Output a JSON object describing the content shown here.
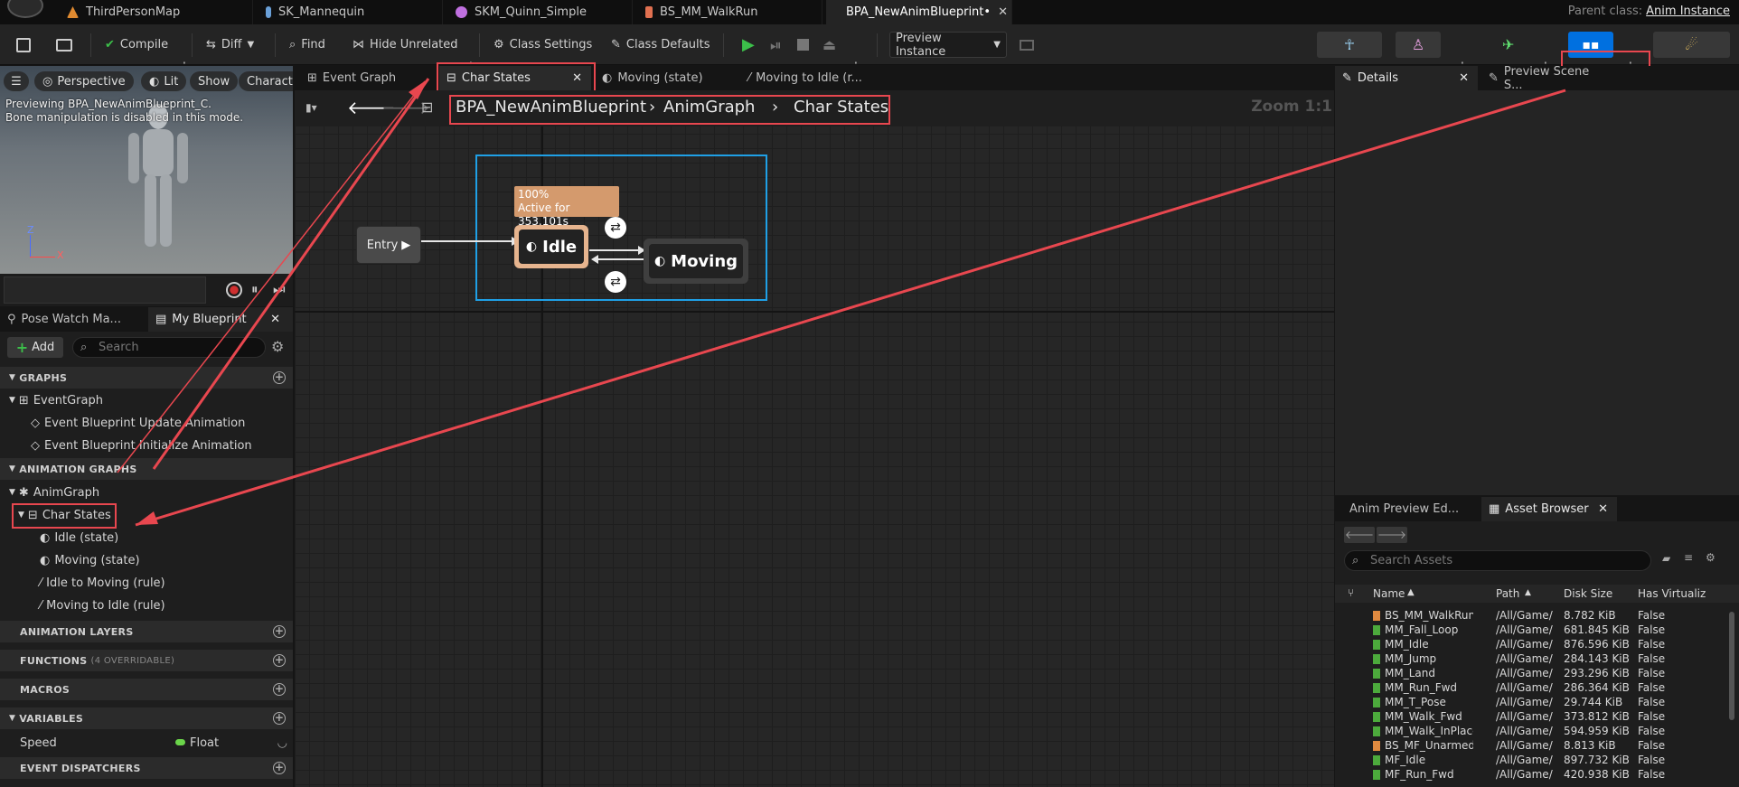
{
  "doc_tabs": [
    {
      "label": "ThirdPersonMap",
      "icon": "level-icon",
      "color": "#e08a30"
    },
    {
      "label": "SK_Mannequin",
      "icon": "skeleton-icon",
      "color": "#6aa0d8"
    },
    {
      "label": "SKM_Quinn_Simple",
      "icon": "skeletal-mesh-icon",
      "color": "#c070e0"
    },
    {
      "label": "BS_MM_WalkRun",
      "icon": "blendspace-icon",
      "color": "#e07050"
    },
    {
      "label": "BPA_NewAnimBlueprint•",
      "icon": "anim-blueprint-icon",
      "color": "#e07050"
    }
  ],
  "parent_class": {
    "label": "Parent class:",
    "value": "Anim Instance"
  },
  "toolbar": {
    "compile": "Compile",
    "diff": "Diff",
    "find": "Find",
    "hide_unrelated": "Hide Unrelated",
    "class_settings": "Class Settings",
    "class_defaults": "Class Defaults",
    "preview_instance": "Preview Instance"
  },
  "viewport": {
    "chips": [
      "Perspective",
      "Lit",
      "Show",
      "Characte"
    ],
    "note_line1": "Previewing BPA_NewAnimBlueprint_C.",
    "note_line2": "Bone manipulation is disabled in this mode."
  },
  "left_tabs": {
    "pose_watch": "Pose Watch Ma...",
    "my_blueprint": "My Blueprint"
  },
  "my_blueprint": {
    "add_label": "Add",
    "search_placeholder": "Search",
    "graphs_header": "GRAPHS",
    "event_graph": "EventGraph",
    "event_update": "Event Blueprint Update Animation",
    "event_init": "Event Blueprint Initialize Animation",
    "anim_graphs_header": "ANIMATION GRAPHS",
    "anim_graph": "AnimGraph",
    "char_states": "Char States",
    "idle_state": "Idle (state)",
    "moving_state": "Moving (state)",
    "idle_to_moving": "Idle to Moving (rule)",
    "moving_to_idle": "Moving to Idle (rule)",
    "anim_layers_header": "ANIMATION LAYERS",
    "functions_header": "FUNCTIONS",
    "functions_note": "(4 OVERRIDABLE)",
    "macros_header": "MACROS",
    "variables_header": "VARIABLES",
    "var_name": "Speed",
    "var_type": "Float",
    "dispatchers_header": "EVENT DISPATCHERS"
  },
  "graph_tabs": [
    "Event Graph",
    "Char States",
    "Moving (state)",
    "Moving to Idle (r..."
  ],
  "breadcrumb": [
    "BPA_NewAnimBlueprint",
    "AnimGraph",
    "Char States"
  ],
  "zoom": "Zoom 1:1",
  "graph": {
    "entry": "Entry",
    "idle": "Idle",
    "moving": "Moving",
    "tooltip_line1": "100%",
    "tooltip_line2": "Active for 353.101s"
  },
  "right_tabs": {
    "details": "Details",
    "preview_scene": "Preview Scene S..."
  },
  "bottom_tabs": {
    "anim_preview": "Anim Preview Ed...",
    "asset_browser": "Asset Browser"
  },
  "asset_browser": {
    "search_placeholder": "Search Assets",
    "columns": [
      "Name",
      "Path",
      "Disk Size",
      "Has Virtualiz"
    ],
    "rows": [
      {
        "name": "BS_MM_WalkRun",
        "path": "/All/Game/",
        "size": "8.782 KiB",
        "virt": "False",
        "type": "blendspace"
      },
      {
        "name": "MM_Fall_Loop",
        "path": "/All/Game/",
        "size": "681.845 KiB",
        "virt": "False",
        "type": "anim"
      },
      {
        "name": "MM_Idle",
        "path": "/All/Game/",
        "size": "876.596 KiB",
        "virt": "False",
        "type": "anim"
      },
      {
        "name": "MM_Jump",
        "path": "/All/Game/",
        "size": "284.143 KiB",
        "virt": "False",
        "type": "anim"
      },
      {
        "name": "MM_Land",
        "path": "/All/Game/",
        "size": "293.296 KiB",
        "virt": "False",
        "type": "anim"
      },
      {
        "name": "MM_Run_Fwd",
        "path": "/All/Game/",
        "size": "286.364 KiB",
        "virt": "False",
        "type": "anim"
      },
      {
        "name": "MM_T_Pose",
        "path": "/All/Game/",
        "size": "29.744 KiB",
        "virt": "False",
        "type": "anim"
      },
      {
        "name": "MM_Walk_Fwd",
        "path": "/All/Game/",
        "size": "373.812 KiB",
        "virt": "False",
        "type": "anim"
      },
      {
        "name": "MM_Walk_InPlace",
        "path": "/All/Game/",
        "size": "594.959 KiB",
        "virt": "False",
        "type": "anim"
      },
      {
        "name": "BS_MF_Unarmed_W",
        "path": "/All/Game/",
        "size": "8.813 KiB",
        "virt": "False",
        "type": "blendspace"
      },
      {
        "name": "MF_Idle",
        "path": "/All/Game/",
        "size": "897.732 KiB",
        "virt": "False",
        "type": "anim"
      },
      {
        "name": "MF_Run_Fwd",
        "path": "/All/Game/",
        "size": "420.938 KiB",
        "virt": "False",
        "type": "anim"
      }
    ]
  },
  "colors": {
    "accent_red": "#e8474f",
    "accent_blue": "#0070e0",
    "selection_blue": "#1fa0e6",
    "idle_node": "#e6b48e",
    "tooltip": "#d49a6d",
    "play_green": "#3cbf4a"
  }
}
